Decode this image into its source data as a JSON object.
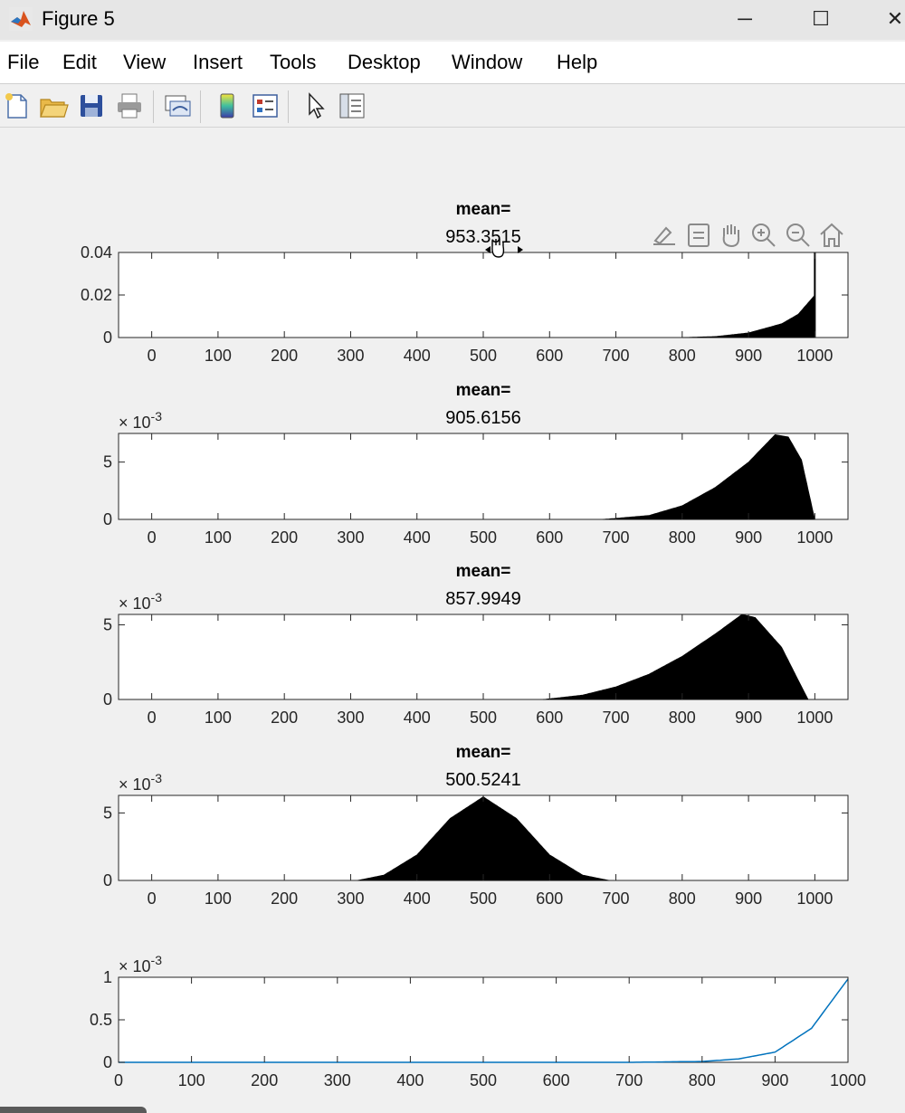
{
  "window": {
    "title": "Figure 5",
    "minimize_glyph": "─",
    "maximize_glyph": "☐",
    "close_glyph": "✕"
  },
  "menubar": {
    "items": [
      "File",
      "Edit",
      "View",
      "Insert",
      "Tools",
      "Desktop",
      "Window",
      "Help"
    ]
  },
  "toolbar": {
    "buttons": [
      "new-figure-icon",
      "open-file-icon",
      "save-icon",
      "print-icon",
      "link-plot-icon",
      "colorbar-icon",
      "legend-icon",
      "edit-plot-arrow-icon",
      "property-inspector-icon"
    ]
  },
  "axes_toolbar": {
    "buttons": [
      "brush-icon",
      "data-tips-icon",
      "pan-hand-icon",
      "zoom-in-icon",
      "zoom-out-icon",
      "home-icon"
    ]
  },
  "colors": {
    "bar_fill": "#000000",
    "line": "#0072bd",
    "axes_bg": "#ffffff",
    "figure_bg": "#f0f0f0"
  },
  "chart_data": [
    {
      "type": "bar",
      "title_line1": "mean=",
      "title_line2": "953.3515",
      "xlim": [
        -50,
        1050
      ],
      "ylim": [
        0,
        0.04
      ],
      "x_ticks": [
        "0",
        "100",
        "200",
        "300",
        "400",
        "500",
        "600",
        "700",
        "800",
        "900",
        "1000"
      ],
      "y_ticks": [
        "0",
        "0.02",
        "0.04"
      ],
      "y_exponent": "",
      "description_points": {
        "x": [
          800,
          850,
          900,
          950,
          975,
          1000
        ],
        "y": [
          0,
          0.0005,
          0.0022,
          0.0065,
          0.011,
          0.02
        ]
      },
      "spike": {
        "x": 1000,
        "y": 0.04
      }
    },
    {
      "type": "bar",
      "title_line1": "mean=",
      "title_line2": "905.6156",
      "xlim": [
        -50,
        1050
      ],
      "ylim": [
        0,
        7.5
      ],
      "x_ticks": [
        "0",
        "100",
        "200",
        "300",
        "400",
        "500",
        "600",
        "700",
        "800",
        "900",
        "1000"
      ],
      "y_ticks": [
        "0",
        "5"
      ],
      "y_exponent": "-3",
      "description_points": {
        "x": [
          680,
          750,
          800,
          850,
          900,
          940,
          960,
          980,
          1000
        ],
        "y": [
          0,
          0.35,
          1.2,
          2.8,
          5.0,
          7.4,
          7.2,
          5.2,
          0
        ]
      }
    },
    {
      "type": "bar",
      "title_line1": "mean=",
      "title_line2": "857.9949",
      "xlim": [
        -50,
        1050
      ],
      "ylim": [
        0,
        5.7
      ],
      "x_ticks": [
        "0",
        "100",
        "200",
        "300",
        "400",
        "500",
        "600",
        "700",
        "800",
        "900",
        "1000"
      ],
      "y_ticks": [
        "0",
        "5"
      ],
      "y_exponent": "-3",
      "description_points": {
        "x": [
          590,
          650,
          700,
          750,
          800,
          850,
          890,
          910,
          950,
          975,
          990
        ],
        "y": [
          0,
          0.3,
          0.85,
          1.7,
          2.9,
          4.4,
          5.7,
          5.5,
          3.5,
          1.3,
          0
        ]
      }
    },
    {
      "type": "bar",
      "title_line1": "mean=",
      "title_line2": "500.5241",
      "xlim": [
        -50,
        1050
      ],
      "ylim": [
        0,
        6.3
      ],
      "x_ticks": [
        "0",
        "100",
        "200",
        "300",
        "400",
        "500",
        "600",
        "700",
        "800",
        "900",
        "1000"
      ],
      "y_ticks": [
        "0",
        "5"
      ],
      "y_exponent": "-3",
      "description_points": {
        "x": [
          310,
          350,
          400,
          450,
          500,
          550,
          600,
          650,
          690
        ],
        "y": [
          0,
          0.4,
          1.9,
          4.6,
          6.2,
          4.6,
          1.9,
          0.4,
          0
        ]
      }
    },
    {
      "type": "line",
      "title_line1": "",
      "title_line2": "",
      "xlim": [
        0,
        1000
      ],
      "ylim": [
        0,
        1
      ],
      "x_ticks": [
        "0",
        "100",
        "200",
        "300",
        "400",
        "500",
        "600",
        "700",
        "800",
        "900",
        "1000"
      ],
      "y_ticks": [
        "0",
        "0.5",
        "1"
      ],
      "y_exponent": "-3",
      "description_points": {
        "x": [
          0,
          700,
          800,
          850,
          900,
          950,
          1000
        ],
        "y": [
          0,
          0,
          0.01,
          0.04,
          0.12,
          0.4,
          0.98
        ]
      }
    }
  ]
}
